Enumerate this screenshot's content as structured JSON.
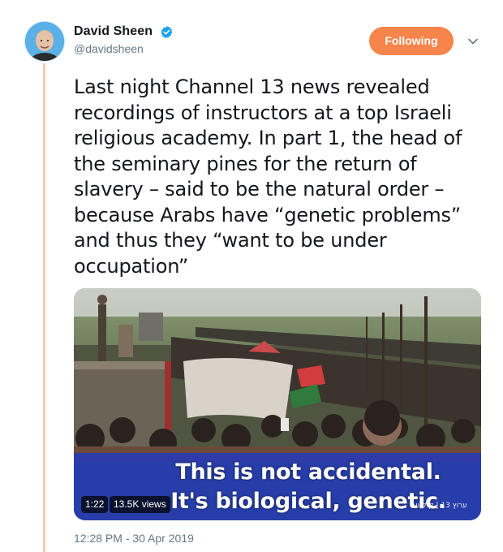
{
  "tweet": {
    "author": {
      "display_name": "David Sheen",
      "handle": "@davidsheen",
      "verified_icon": "verified-badge-icon"
    },
    "follow_button_label": "Following",
    "menu_icon": "chevron-down-icon",
    "text": "Last night Channel 13 news revealed recordings of instructors at a top Israeli religious academy. In part 1, the head of the seminary pines for the return of slavery – said to be the natural order – because Arabs have “genetic problems” and thus they “want to be under occupation”",
    "media": {
      "subtitle_line1": "This is not accidental.",
      "subtitle_line2": "It's biological, genetic.",
      "duration": "1:22",
      "views": "13.5K views",
      "channel_credit": "ערוץ 13 | קולנוע"
    },
    "timestamp": "12:28 PM - 30 Apr 2019"
  },
  "colors": {
    "accent": "#f7844a",
    "thread_line": "#f7c9ad",
    "verified": "#1da1f2",
    "text": "#14171a",
    "muted": "#657786",
    "subtitle_band": "#1836d2"
  }
}
